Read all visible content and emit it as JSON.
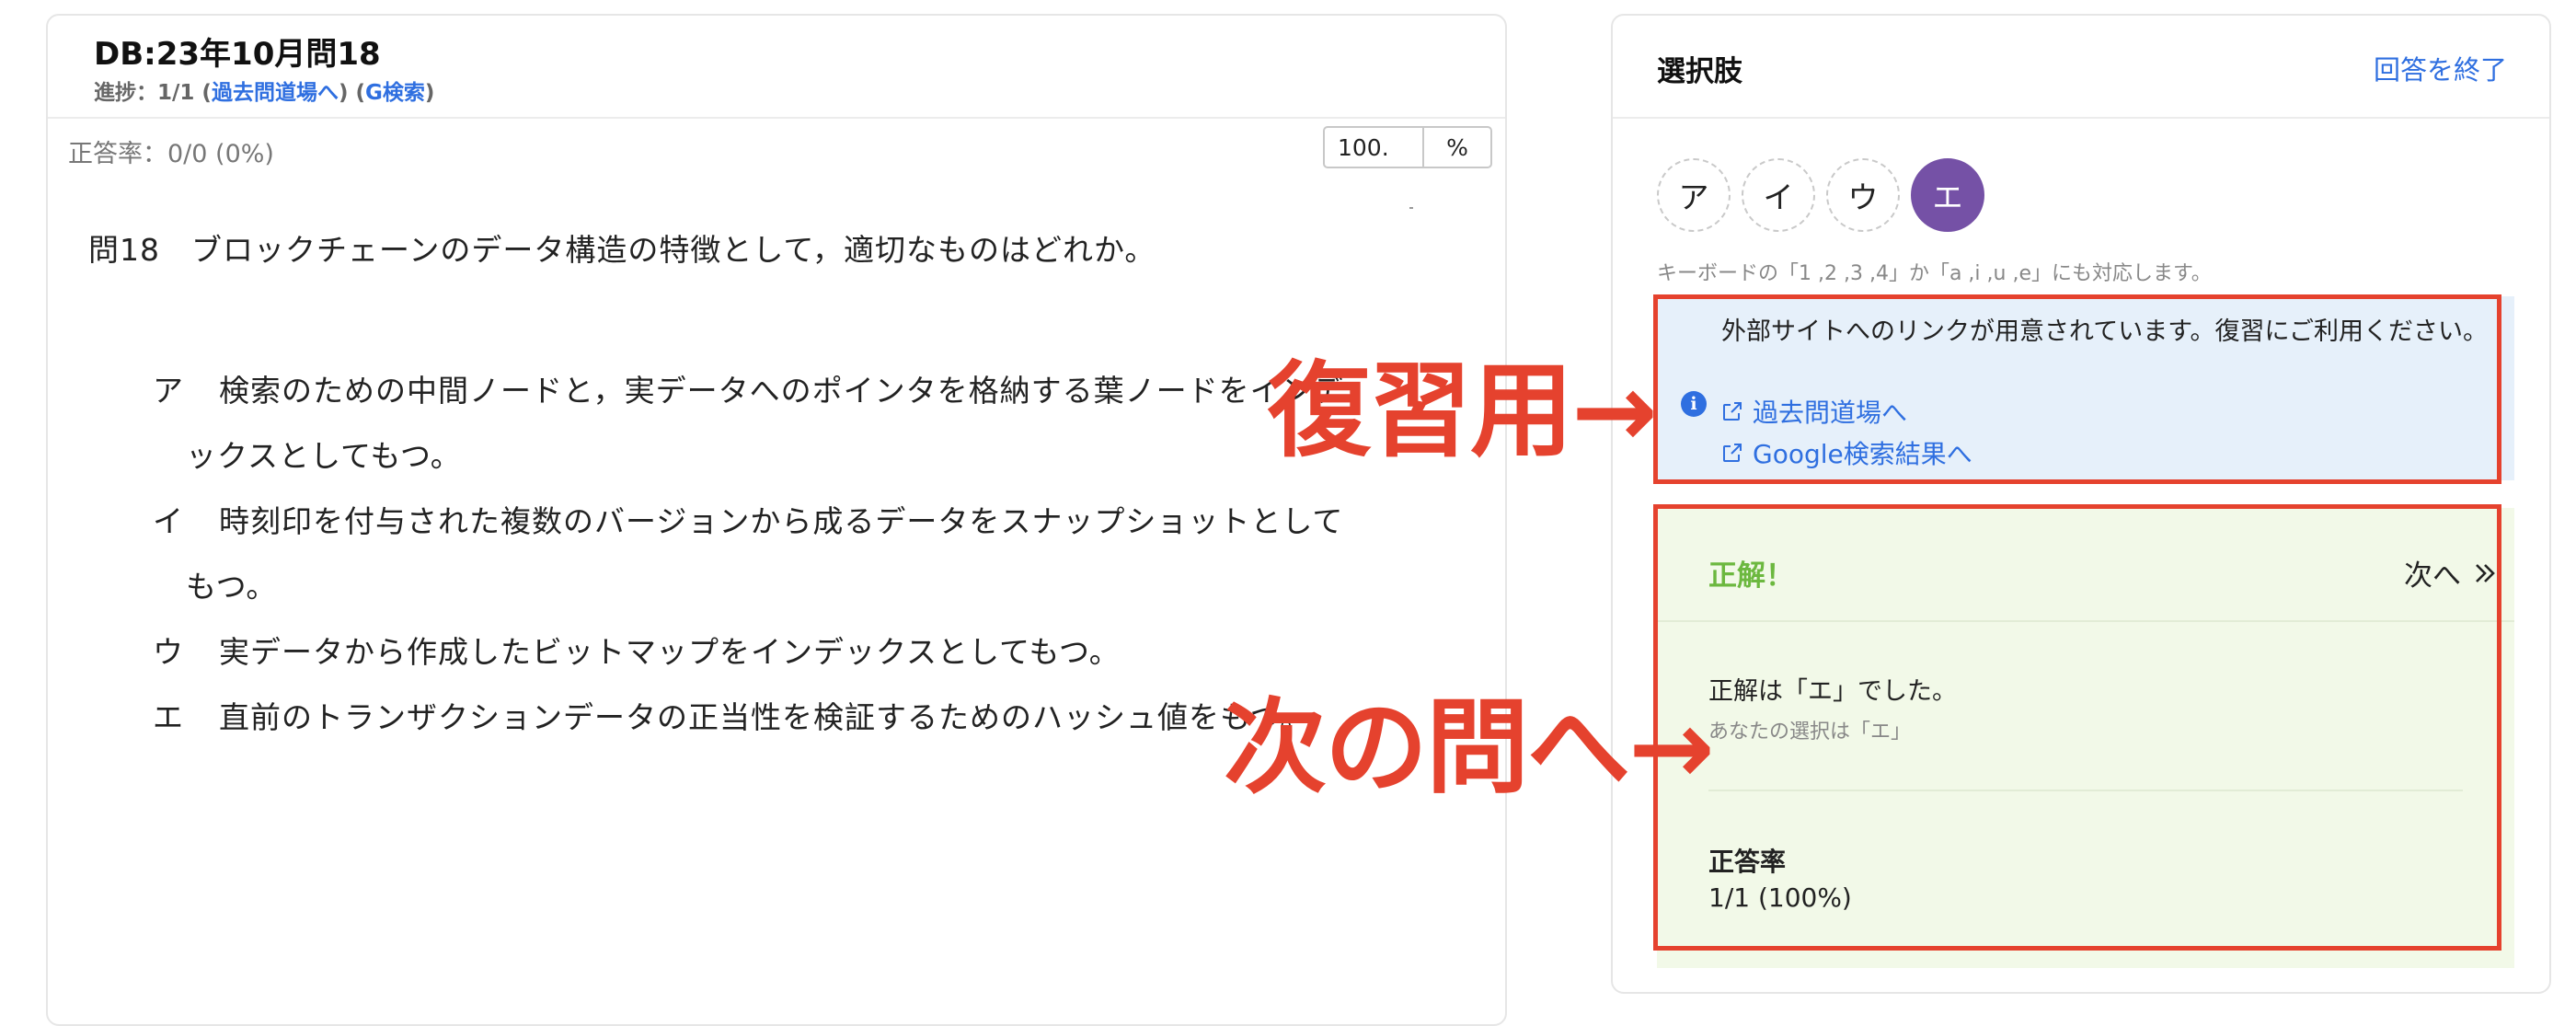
{
  "left": {
    "title": "DB:23年10月問18",
    "progress_prefix": "進捗：1/1 (",
    "progress_link1": "過去問道場へ",
    "progress_mid": ") (",
    "progress_link2": "G検索",
    "progress_suffix": ")",
    "rate": "正答率：0/0 (0%)",
    "zoom_value": "100.",
    "zoom_unit": "%",
    "question": "問18　ブロックチェーンのデータ構造の特徴として，適切なものはどれか。",
    "choices": [
      {
        "kana": "ア",
        "line1": "検索のための中間ノードと，実データへのポインタを格納する葉ノードをインデ",
        "line2": "ックスとしてもつ。"
      },
      {
        "kana": "イ",
        "line1": "時刻印を付与された複数のバージョンから成るデータをスナップショットとして",
        "line2": "もつ。"
      },
      {
        "kana": "ウ",
        "line1": "実データから作成したビットマップをインデックスとしてもつ。",
        "line2": ""
      },
      {
        "kana": "エ",
        "line1": "直前のトランザクションデータの正当性を検証するためのハッシュ値をもつ。",
        "line2": ""
      }
    ]
  },
  "right": {
    "title": "選択肢",
    "end_link": "回答を終了",
    "buttons": [
      "ア",
      "イ",
      "ウ",
      "エ"
    ],
    "selected": "エ",
    "keyboard_hint": "キーボードの「1 ,2 ,3 ,4」か「a ,i ,u ,e」にも対応します。",
    "info_text": "外部サイトへのリンクが用意されています。復習にご利用ください。",
    "info_link1": "過去問道場へ",
    "info_link2": "Google検索結果へ",
    "result_label": "正解！",
    "next_label": "次へ",
    "correct_answer": "正解は「エ」でした。",
    "your_answer": "あなたの選択は「エ」",
    "rate_label": "正答率",
    "rate_value": "1/1 (100%)"
  },
  "annotations": {
    "review": "復習用→",
    "next": "次の問へ→",
    "color": "#e5422e"
  },
  "colors": {
    "link": "#2f6fe0",
    "selected": "#7551a6",
    "correct": "#6cb83f",
    "info_bg": "#e6f0fa",
    "result_bg": "#f2f9e8"
  }
}
